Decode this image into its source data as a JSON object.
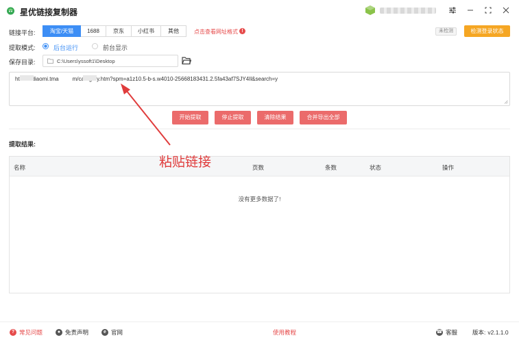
{
  "app": {
    "title": "星优链接复制器"
  },
  "window": {
    "settings_icon": "sliders-icon",
    "minimize_icon": "minimize-icon",
    "maximize_icon": "maximize-icon",
    "close_icon": "close-icon"
  },
  "platform": {
    "label": "链接平台:",
    "tabs": [
      {
        "label": "淘宝/天猫",
        "active": true
      },
      {
        "label": "1688",
        "active": false
      },
      {
        "label": "京东",
        "active": false
      },
      {
        "label": "小红书",
        "active": false
      },
      {
        "label": "其他",
        "active": false
      }
    ],
    "hint_link": "点击查看网址格式",
    "login_status": "未检测",
    "check_login_button": "检测登录状态"
  },
  "mode": {
    "label": "提取模式:",
    "options": [
      {
        "label": "后台运行",
        "selected": true
      },
      {
        "label": "前台显示",
        "selected": false
      }
    ]
  },
  "save_dir": {
    "label": "保存目录:",
    "value": "C:\\Users\\yssoft1\\Desktop"
  },
  "url_input": {
    "value": "ht      //diaomi.tma         m/category.htm?spm=a1z10.5-b-s.w4010-25668183431.2.5fa43af7SJY4Il&search=y"
  },
  "actions": {
    "start": "开始提取",
    "stop": "停止提取",
    "clear": "清除结果",
    "export": "合并导出全部"
  },
  "results": {
    "title": "提取结果:",
    "columns": [
      "名称",
      "页数",
      "条数",
      "状态",
      "操作"
    ],
    "empty_text": "没有更多数据了!"
  },
  "annotation": {
    "text": "粘贴链接",
    "color": "#e03c3c"
  },
  "footer": {
    "faq": "常见问题",
    "disclaimer": "免责声明",
    "website": "官网",
    "tutorial": "使用教程",
    "support": "客服",
    "version_label": "版本:",
    "version": "v2.1.1.0"
  },
  "colors": {
    "primary": "#3d8ef5",
    "action": "#eb6b6b",
    "warning": "#f5a623",
    "link": "#e64b4b"
  }
}
